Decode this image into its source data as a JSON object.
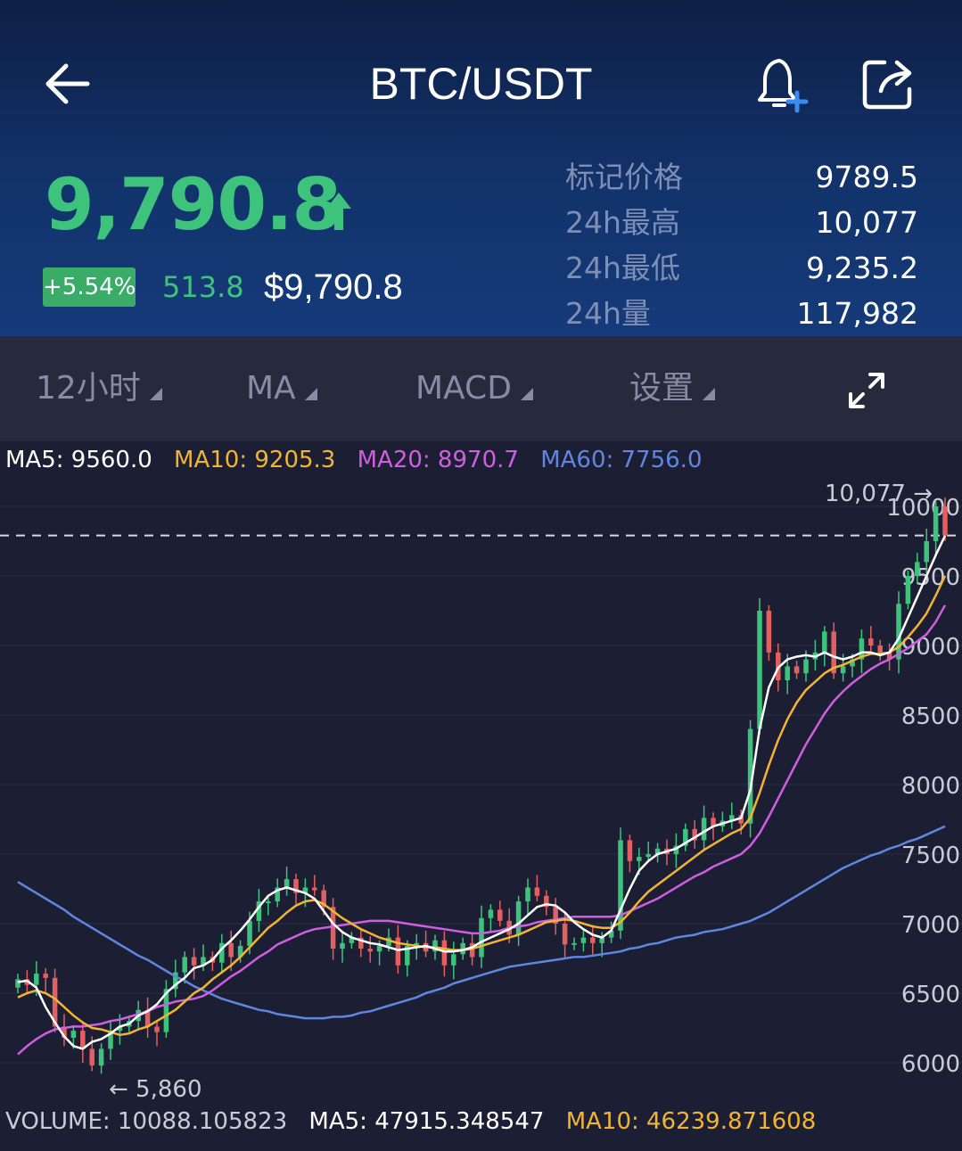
{
  "header": {
    "title": "BTC/USDT",
    "price": "9,790.8",
    "change_percent": "+5.54%",
    "change_value": "513.8",
    "usd_price": "$9,790.8",
    "stats": [
      {
        "label": "标记价格",
        "value": "9789.5"
      },
      {
        "label": "24h最高",
        "value": "10,077"
      },
      {
        "label": "24h最低",
        "value": "9,235.2"
      },
      {
        "label": "24h量",
        "value": "117,982"
      }
    ]
  },
  "toolbar": {
    "interval": "12小时",
    "main_indicator": "MA",
    "sub_indicator": "MACD",
    "settings": "设置"
  },
  "colors": {
    "up": "#3ec37c",
    "down": "#e2605f",
    "ma5": "#ffffff",
    "ma10": "#f2b531",
    "ma20": "#d05ee0",
    "ma60": "#5f86e0"
  },
  "ma_legend": {
    "ma5": "MA5: 9560.0",
    "ma10": "MA10: 9205.3",
    "ma20": "MA20: 8970.7",
    "ma60": "MA60: 7756.0"
  },
  "volume_legend": {
    "volume": "VOLUME: 10088.105823",
    "ma5": "MA5: 47915.348547",
    "ma10": "MA10: 46239.871608"
  },
  "chart_data": {
    "type": "candlestick",
    "y_ticks": [
      {
        "label": "10000",
        "value": 10000
      },
      {
        "label": "9500",
        "value": 9500
      },
      {
        "label": "9000",
        "value": 9000
      },
      {
        "label": "8500",
        "value": 8500
      },
      {
        "label": "8000",
        "value": 8000
      },
      {
        "label": "7500",
        "value": 7500
      },
      {
        "label": "7000",
        "value": 7000
      },
      {
        "label": "6500",
        "value": 6500
      },
      {
        "label": "6000",
        "value": 6000
      }
    ],
    "high_marker": {
      "label": "10,077",
      "value": 10077
    },
    "low_marker": {
      "label": "5,860",
      "value": 5860
    },
    "last_price": 9790.8,
    "closes": [
      6600,
      6560,
      6640,
      6610,
      6260,
      6180,
      6230,
      6100,
      5980,
      6100,
      6230,
      6260,
      6300,
      6380,
      6260,
      6220,
      6530,
      6650,
      6760,
      6700,
      6760,
      6720,
      6860,
      6760,
      6840,
      7020,
      7160,
      7160,
      7260,
      7320,
      7220,
      7260,
      7240,
      7120,
      6820,
      6860,
      6900,
      6820,
      6800,
      6840,
      6900,
      6700,
      6840,
      6860,
      6800,
      6880,
      6700,
      6780,
      6860,
      6760,
      7040,
      7100,
      7020,
      6920,
      7160,
      7260,
      7200,
      7120,
      7000,
      6850,
      6860,
      6900,
      6860,
      6900,
      6950,
      7600,
      7450,
      7480,
      7500,
      7540,
      7500,
      7560,
      7680,
      7600,
      7760,
      7700,
      7740,
      7780,
      7720,
      8400,
      9250,
      8950,
      8750,
      8850,
      8800,
      8900,
      8950,
      9100,
      8800,
      8850,
      8900,
      9050,
      9000,
      8950,
      8900,
      9300,
      9500,
      9600,
      9750,
      10000,
      9790.8
    ],
    "ma5": [
      6580,
      6590,
      6540,
      6400,
      6290,
      6190,
      6120,
      6100,
      6150,
      6170,
      6210,
      6260,
      6280,
      6340,
      6370,
      6420,
      6500,
      6560,
      6610,
      6680,
      6700,
      6740,
      6820,
      6880,
      6950,
      7030,
      7120,
      7200,
      7240,
      7260,
      7240,
      7220,
      7180,
      7090,
      7000,
      6940,
      6900,
      6880,
      6860,
      6850,
      6830,
      6810,
      6820,
      6830,
      6840,
      6820,
      6800,
      6800,
      6810,
      6830,
      6870,
      6900,
      6930,
      6960,
      7000,
      7060,
      7120,
      7140,
      7130,
      7080,
      7010,
      6960,
      6920,
      6900,
      6950,
      7100,
      7250,
      7380,
      7450,
      7500,
      7520,
      7540,
      7580,
      7620,
      7660,
      7700,
      7720,
      7740,
      7760,
      7960,
      8400,
      8700,
      8840,
      8900,
      8920,
      8930,
      8920,
      8950,
      8920,
      8900,
      8920,
      8950,
      8950,
      8930,
      8950,
      9050,
      9200,
      9350,
      9500,
      9650,
      9790
    ],
    "ma10": [
      6470,
      6500,
      6520,
      6500,
      6460,
      6400,
      6340,
      6290,
      6250,
      6240,
      6220,
      6200,
      6210,
      6240,
      6260,
      6300,
      6340,
      6380,
      6440,
      6500,
      6540,
      6600,
      6650,
      6700,
      6760,
      6830,
      6900,
      6970,
      7020,
      7080,
      7130,
      7160,
      7170,
      7140,
      7090,
      7040,
      7000,
      6960,
      6930,
      6900,
      6880,
      6860,
      6850,
      6840,
      6830,
      6830,
      6820,
      6810,
      6810,
      6820,
      6840,
      6860,
      6880,
      6900,
      6920,
      6950,
      6980,
      7010,
      7020,
      7030,
      7020,
      7000,
      6980,
      6970,
      6970,
      7010,
      7080,
      7160,
      7230,
      7280,
      7330,
      7380,
      7430,
      7480,
      7530,
      7570,
      7610,
      7650,
      7680,
      7760,
      7940,
      8140,
      8320,
      8470,
      8590,
      8680,
      8740,
      8800,
      8840,
      8860,
      8890,
      8920,
      8940,
      8940,
      8950,
      8990,
      9060,
      9140,
      9230,
      9360,
      9500
    ],
    "ma20": [
      6060,
      6120,
      6170,
      6210,
      6240,
      6250,
      6260,
      6260,
      6270,
      6280,
      6300,
      6310,
      6330,
      6350,
      6370,
      6400,
      6420,
      6440,
      6450,
      6460,
      6480,
      6520,
      6570,
      6620,
      6660,
      6710,
      6760,
      6800,
      6850,
      6880,
      6910,
      6940,
      6960,
      6970,
      6980,
      6990,
      7000,
      7010,
      7020,
      7020,
      7020,
      7010,
      7000,
      6990,
      6980,
      6970,
      6960,
      6950,
      6940,
      6930,
      6930,
      6940,
      6950,
      6970,
      6980,
      6990,
      7010,
      7020,
      7030,
      7040,
      7050,
      7050,
      7050,
      7050,
      7050,
      7060,
      7090,
      7120,
      7150,
      7180,
      7220,
      7260,
      7300,
      7340,
      7370,
      7410,
      7440,
      7470,
      7500,
      7560,
      7650,
      7770,
      7900,
      8030,
      8160,
      8290,
      8400,
      8510,
      8600,
      8670,
      8730,
      8780,
      8830,
      8870,
      8900,
      8940,
      8980,
      9030,
      9080,
      9170,
      9290
    ],
    "ma60": [
      7300,
      7260,
      7220,
      7180,
      7140,
      7100,
      7050,
      7010,
      6970,
      6930,
      6890,
      6850,
      6810,
      6770,
      6740,
      6700,
      6660,
      6620,
      6590,
      6550,
      6520,
      6490,
      6460,
      6440,
      6420,
      6400,
      6380,
      6370,
      6350,
      6340,
      6330,
      6320,
      6320,
      6320,
      6330,
      6330,
      6340,
      6360,
      6370,
      6390,
      6410,
      6430,
      6450,
      6470,
      6500,
      6520,
      6540,
      6570,
      6590,
      6610,
      6630,
      6650,
      6670,
      6690,
      6700,
      6710,
      6720,
      6730,
      6740,
      6750,
      6760,
      6760,
      6770,
      6780,
      6790,
      6800,
      6820,
      6830,
      6850,
      6860,
      6880,
      6900,
      6910,
      6920,
      6940,
      6950,
      6960,
      6980,
      7000,
      7020,
      7050,
      7080,
      7120,
      7160,
      7200,
      7240,
      7280,
      7320,
      7360,
      7400,
      7430,
      7460,
      7490,
      7510,
      7540,
      7560,
      7590,
      7610,
      7640,
      7670,
      7700
    ]
  }
}
